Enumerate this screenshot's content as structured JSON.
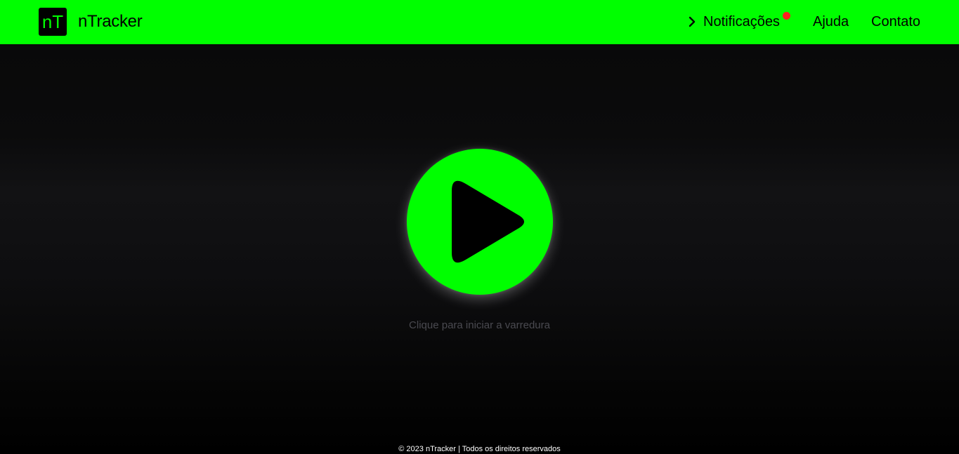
{
  "header": {
    "logo_text": "nT",
    "brand": "nTracker",
    "nav": {
      "notifications": "Notificações",
      "help": "Ajuda",
      "contact": "Contato"
    }
  },
  "main": {
    "caption": "Clique para iniciar a varredura"
  },
  "footer": {
    "text": "© 2023 nTracker | Todos os direitos reservados"
  },
  "colors": {
    "accent": "#00ff00",
    "notification_dot": "#ff1f1f",
    "background": "#0b0b0c"
  },
  "icons": {
    "nav_chevron": "chevron-right-icon",
    "play": "play-icon"
  }
}
